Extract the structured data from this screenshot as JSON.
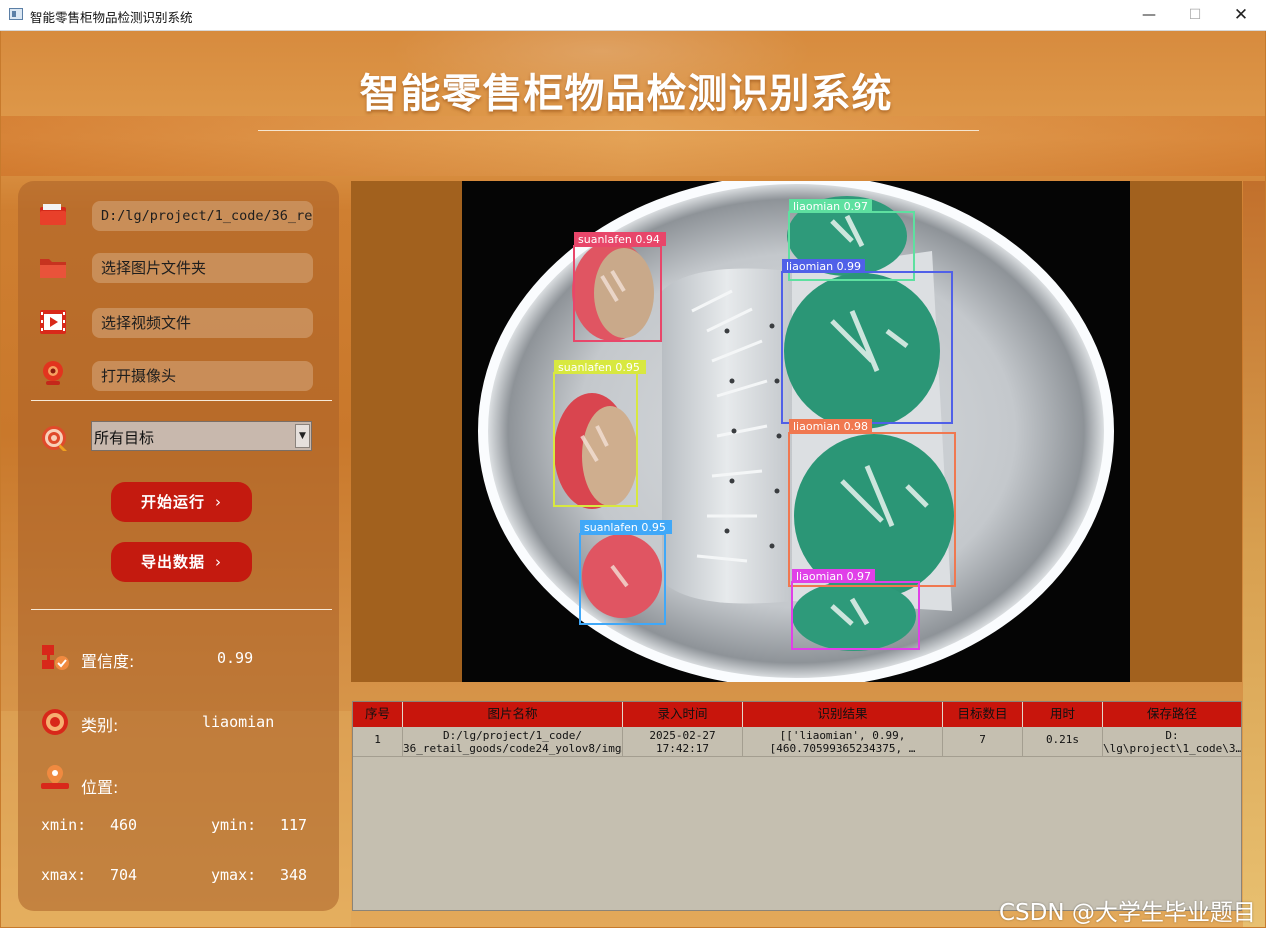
{
  "window": {
    "title": "智能零售柜物品检测识别系统",
    "minimize_glyph": "—",
    "maximize_glyph": "☐",
    "close_glyph": "✕"
  },
  "header": {
    "title": "智能零售柜物品检测识别系统"
  },
  "left_panel": {
    "path_value": "D:/lg/project/1_code/36_ret",
    "select_folder_label": "选择图片文件夹",
    "select_video_label": "选择视频文件",
    "open_camera_label": "打开摄像头",
    "target_select_value": "所有目标",
    "start_button": "开始运行",
    "export_button": "导出数据",
    "chevron": "›",
    "confidence_label": "置信度:",
    "confidence_value": "0.99",
    "class_label": "类别:",
    "class_value": "liaomian",
    "position_label": "位置:",
    "xmin_label": "xmin:",
    "xmin_value": "460",
    "ymin_label": "ymin:",
    "ymin_value": "117",
    "xmax_label": "xmax:",
    "xmax_value": "704",
    "ymax_label": "ymax:",
    "ymax_value": "348"
  },
  "detections": [
    {
      "label": "suanlafen 0.94",
      "color": "#e8466a"
    },
    {
      "label": "liaomian 0.97",
      "color": "#5ee0a0"
    },
    {
      "label": "liaomian 0.99",
      "color": "#5060e8"
    },
    {
      "label": "suanlafen 0.95",
      "color": "#d8e840"
    },
    {
      "label": "liaomian 0.98",
      "color": "#f07850"
    },
    {
      "label": "suanlafen 0.95",
      "color": "#40a8f8"
    },
    {
      "label": "liaomian 0.97",
      "color": "#e040e8"
    }
  ],
  "table": {
    "headers": [
      "序号",
      "图片名称",
      "录入时间",
      "识别结果",
      "目标数目",
      "用时",
      "保存路径"
    ],
    "row": {
      "index": "1",
      "name_line1": "D:/lg/project/1_code/",
      "name_line2": "36_retail_goods/code24_yolov8/img…",
      "time_line1": "2025-02-27",
      "time_line2": "17:42:17",
      "result_line1": "[['liaomian', 0.99,",
      "result_line2": "[460.70599365234375, …",
      "count": "7",
      "elapsed": "0.21s",
      "path_line1": "D:",
      "path_line2": "\\lg\\project\\1_code\\3…"
    }
  },
  "watermark": "CSDN @大学生毕业题目",
  "colors": {
    "accent_red": "#c41a0f",
    "table_header": "#c8150c",
    "background_orange": "#c9782b"
  }
}
